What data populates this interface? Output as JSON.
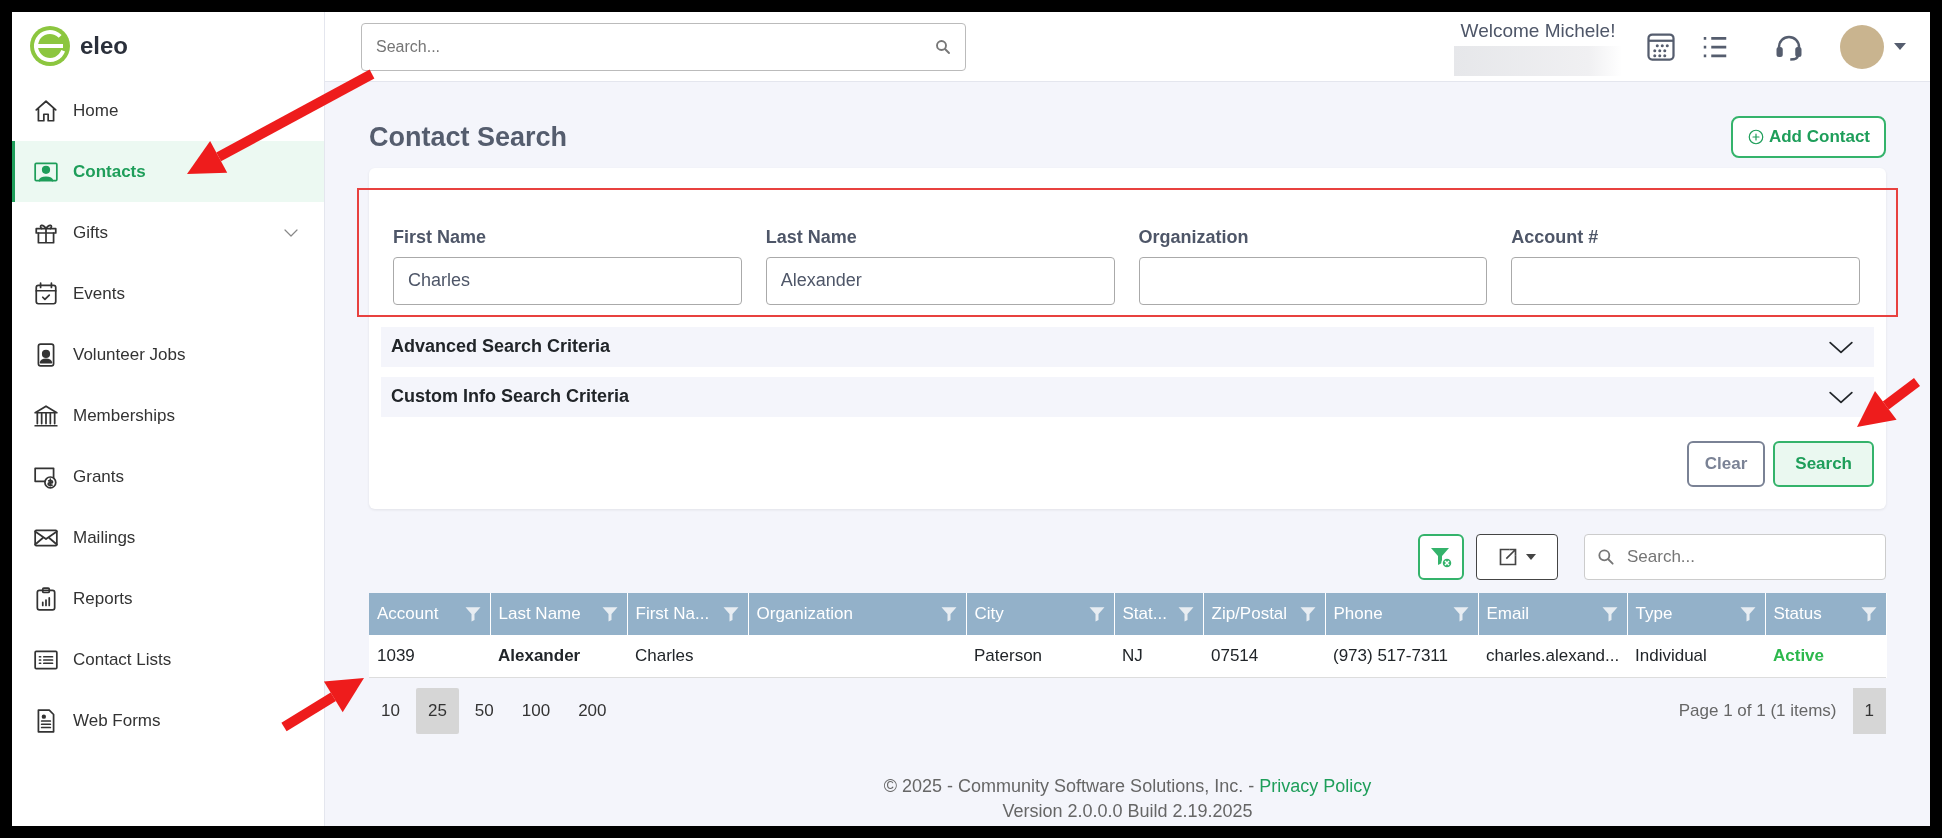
{
  "brand": {
    "name": "eleo"
  },
  "sidebar": {
    "items": [
      {
        "label": "Home",
        "selected": false
      },
      {
        "label": "Contacts",
        "selected": true
      },
      {
        "label": "Gifts",
        "selected": false,
        "expandable": true
      },
      {
        "label": "Events",
        "selected": false
      },
      {
        "label": "Volunteer Jobs",
        "selected": false
      },
      {
        "label": "Memberships",
        "selected": false
      },
      {
        "label": "Grants",
        "selected": false
      },
      {
        "label": "Mailings",
        "selected": false
      },
      {
        "label": "Reports",
        "selected": false
      },
      {
        "label": "Contact Lists",
        "selected": false
      },
      {
        "label": "Web Forms",
        "selected": false
      }
    ]
  },
  "topbar": {
    "search": {
      "placeholder": "Search..."
    },
    "welcome": "Welcome Michele!"
  },
  "page": {
    "title": "Contact Search",
    "add_button": "Add Contact"
  },
  "search_form": {
    "fields": [
      {
        "label": "First Name",
        "value": "Charles"
      },
      {
        "label": "Last Name",
        "value": "Alexander"
      },
      {
        "label": "Organization"
      },
      {
        "label": "Account #"
      }
    ],
    "sections": [
      {
        "label": "Advanced Search Criteria",
        "expanded": false
      },
      {
        "label": "Custom Info Search Criteria",
        "expanded": false
      }
    ],
    "buttons": [
      {
        "label": "Clear",
        "kind": "secondary"
      },
      {
        "label": "Search",
        "kind": "primary"
      }
    ]
  },
  "table": {
    "search": {
      "placeholder": "Search..."
    },
    "columns": [
      "Account",
      "Last Name",
      "First Na...",
      "Organization",
      "City",
      "Stat...",
      "Zip/Postal",
      "Phone",
      "Email",
      "Type",
      "Status"
    ],
    "rows": [
      {
        "cells": [
          "1039",
          "Alexander",
          "Charles",
          "",
          "Paterson",
          "NJ",
          "07514",
          "(973) 517-7311",
          "charles.alexand...",
          "Individual",
          "Active"
        ]
      }
    ]
  },
  "pagination": {
    "page_sizes": [
      {
        "label": "10",
        "selected": false
      },
      {
        "label": "25",
        "selected": true
      },
      {
        "label": "50",
        "selected": false
      },
      {
        "label": "100",
        "selected": false
      },
      {
        "label": "200",
        "selected": false
      }
    ],
    "info": "Page 1 of 1 (1 items)",
    "pages": [
      {
        "label": "1",
        "selected": true
      }
    ]
  },
  "footer": {
    "copyright": "© 2025 - Community Software Solutions, Inc. -",
    "link": "Privacy Policy",
    "version": "Version 2.0.0.0 Build 2.19.2025"
  }
}
